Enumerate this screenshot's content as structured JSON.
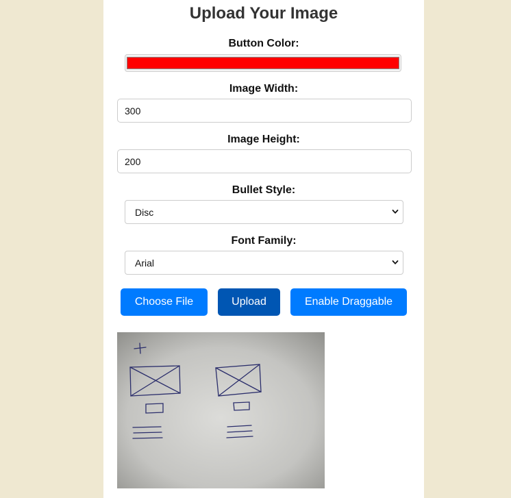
{
  "form": {
    "title": "Upload Your Image",
    "button_color_label": "Button Color:",
    "button_color_value": "#ff0000",
    "width_label": "Image Width:",
    "width_value": "300",
    "height_label": "Image Height:",
    "height_value": "200",
    "bullet_label": "Bullet Style:",
    "bullet_value": "Disc",
    "font_label": "Font Family:",
    "font_value": "Arial"
  },
  "buttons": {
    "choose_file": "Choose File",
    "upload": "Upload",
    "draggable": "Enable Draggable"
  },
  "colors": {
    "page_background": "#efe8d1",
    "button_primary": "#007bff",
    "button_pressed": "#0056b3"
  }
}
